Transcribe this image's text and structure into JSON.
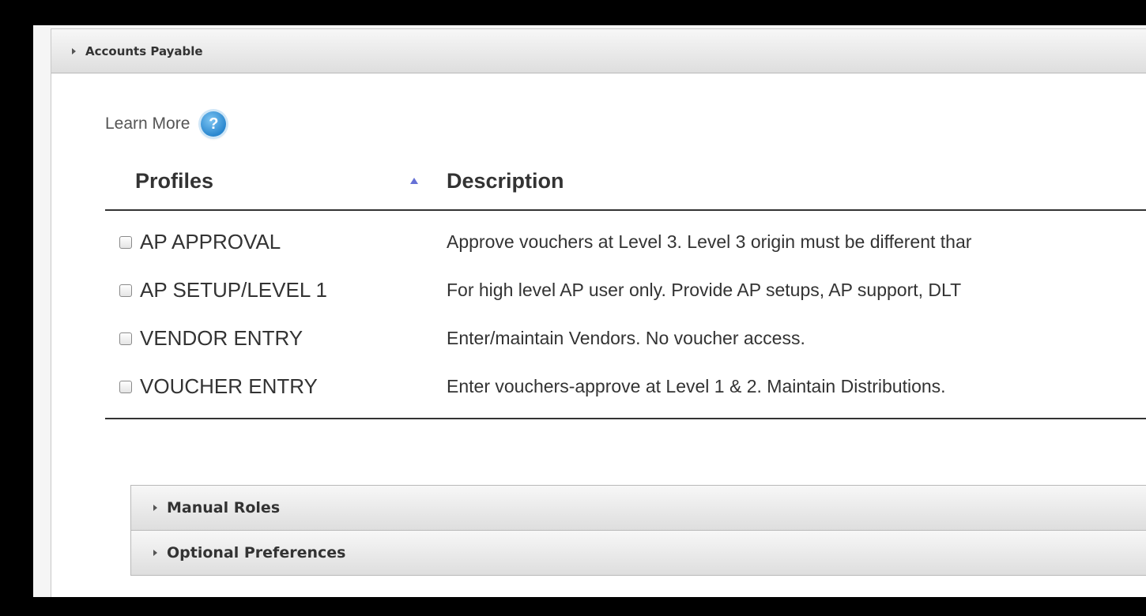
{
  "section": {
    "title": "Accounts Payable"
  },
  "learn_more": {
    "label": "Learn More",
    "icon": "help-icon",
    "icon_glyph": "?"
  },
  "table": {
    "headers": {
      "profiles": "Profiles",
      "description": "Description"
    },
    "sort_direction": "ascending",
    "rows": [
      {
        "profile": "AP APPROVAL",
        "description": "Approve vouchers at Level 3. Level 3 origin must be different thar",
        "checked": false
      },
      {
        "profile": "AP SETUP/LEVEL 1",
        "description": "For high level AP user only. Provide AP setups, AP support, DLT",
        "checked": false
      },
      {
        "profile": "VENDOR ENTRY",
        "description": "Enter/maintain Vendors. No voucher access.",
        "checked": false
      },
      {
        "profile": "VOUCHER ENTRY",
        "description": "Enter vouchers-approve at Level 1 & 2. Maintain Distributions.",
        "checked": false
      }
    ]
  },
  "subsections": [
    {
      "title": "Manual Roles"
    },
    {
      "title": "Optional Preferences"
    }
  ],
  "colors": {
    "sort_arrow": "#6671d6",
    "help_icon": "#2a87cf"
  }
}
